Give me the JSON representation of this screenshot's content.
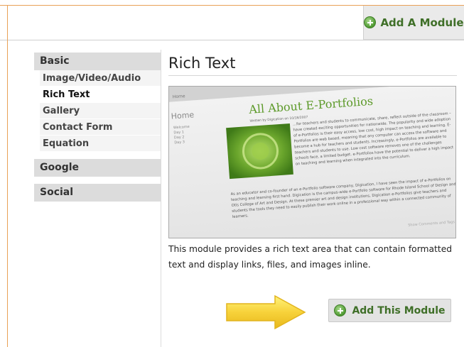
{
  "header": {
    "add_module_label": "Add A Module",
    "add_module_icon": "plus-circle-icon"
  },
  "sidebar": {
    "groups": [
      {
        "label": "Basic",
        "items": [
          {
            "label": "Image/Video/Audio"
          },
          {
            "label": "Rich Text",
            "active": true
          },
          {
            "label": "Gallery"
          },
          {
            "label": "Contact Form"
          },
          {
            "label": "Equation"
          }
        ]
      },
      {
        "label": "Google"
      },
      {
        "label": "Social"
      }
    ]
  },
  "content": {
    "title": "Rich Text",
    "preview": {
      "tab": "Home",
      "nav_title": "Home",
      "nav_items": [
        "Welcome",
        "Day 1",
        "Day 2",
        "Day 3"
      ],
      "article_title": "All About E-Portfolios",
      "byline": "Written by Digication on 10/18/2007",
      "paragraphs": [
        "…for teachers and students to communicate, share, reflect outside of the classroom – have created exciting opportunities for nationwide. The popularity and wide adoption of e-Portfolios is their easy access, low cost, high impact on teaching and learning. E-Portfolios are web based, meaning that any computer can access the software and become a hub for teachers and students. Increasingly, e-Portfolios are available to teachers and students to use. Low cost software removes one of the challenges schools face, a limited budget. e-Portfolios have the potential to deliver a high impact on teaching and learning when integrated into the curriculum.",
        "As an educator and co-founder of an e-Portfolio software company, Digication, I have seen the impact of e-Portfolios on teaching and learning first hand. Digication is the campus-wide e-Portfolio software for Rhode Island School of Design and Otis College of Art and Design. At these premier art and design institutions, Digication e-Portfolios give teachers and students the tools they need to easily publish their work online in a professional way within a connected community of learners."
      ],
      "footer_link": "Show Comments and Tags"
    },
    "description": "This module provides a rich text area that can contain formatted text and display links, files, and images inline.",
    "add_this_label": "Add This Module",
    "add_this_icon": "plus-circle-icon"
  },
  "colors": {
    "accent_green": "#3f6f28",
    "orange_border": "#e9a157",
    "arrow_yellow": "#f7d23a"
  }
}
